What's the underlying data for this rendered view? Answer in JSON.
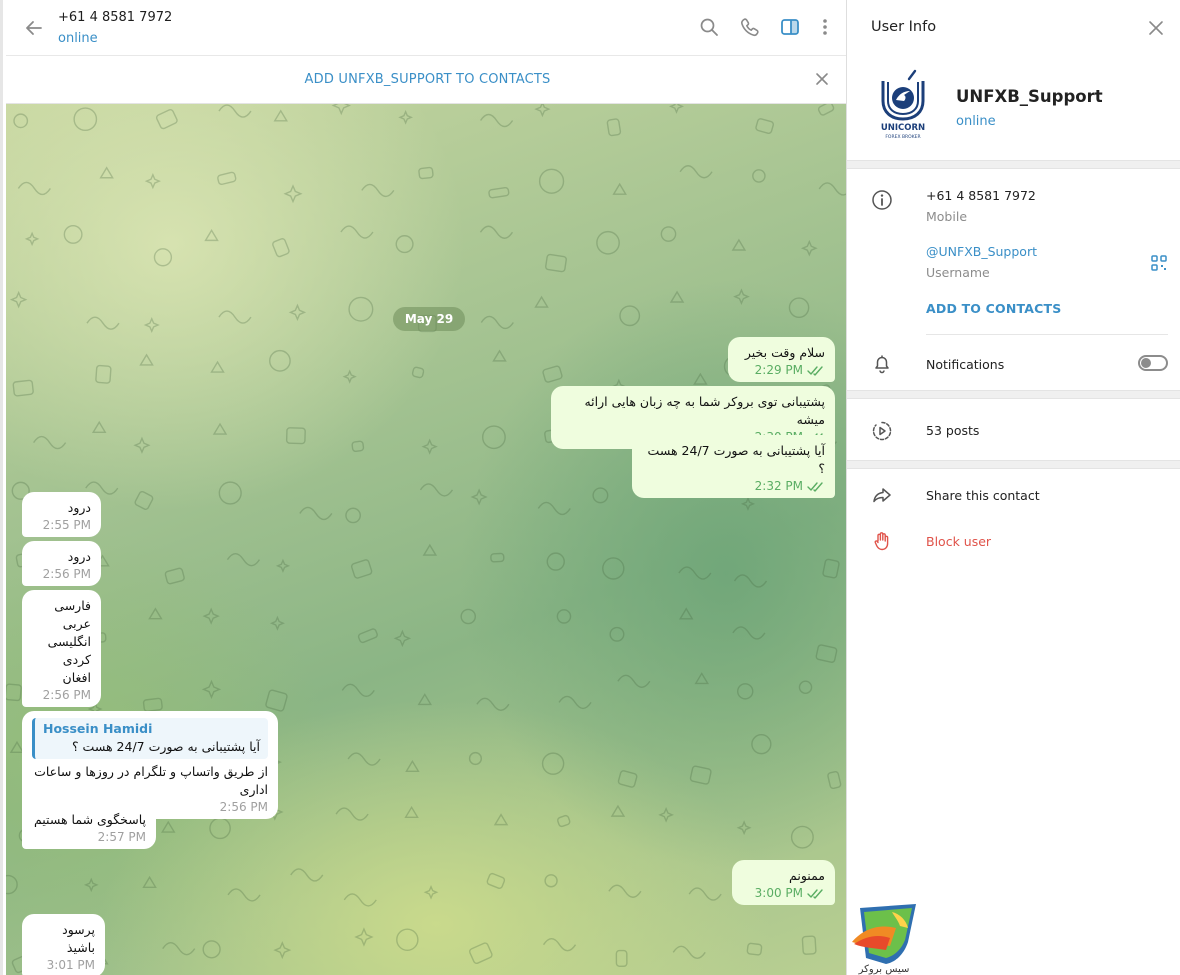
{
  "header": {
    "title": "+61 4 8581 7972",
    "status": "online"
  },
  "add_bar": {
    "label": "ADD UNFXB_SUPPORT TO CONTACTS"
  },
  "chat": {
    "date_label": "May 29",
    "messages": [
      {
        "dir": "out",
        "text": "سلام وقت بخیر",
        "time": "2:29 PM"
      },
      {
        "dir": "out",
        "text": "پشتیبانی توی بروکر شما به چه زبان هایی ارائه میشه",
        "time": "2:30 PM"
      },
      {
        "dir": "out",
        "text": "آیا پشتیبانی به صورت 24/7 هست ؟",
        "time": "2:32 PM"
      },
      {
        "dir": "in",
        "text": "درود",
        "time": "2:55 PM"
      },
      {
        "dir": "in",
        "text": "درود",
        "time": "2:56 PM"
      },
      {
        "dir": "in",
        "text": "فارسی\nعربی\nانگلیسی\nکردی\nافغان",
        "time": "2:56 PM"
      },
      {
        "dir": "in",
        "quote_name": "Hossein Hamidi",
        "quote_text": "آیا پشتیبانی به صورت 24/7 هست ؟",
        "text": "از طریق واتساپ و تلگرام در روزها و ساعات اداری",
        "time": "2:56 PM"
      },
      {
        "dir": "in",
        "text": "پاسخگوی شما هستیم",
        "time": "2:57 PM"
      },
      {
        "dir": "out",
        "text": "ممنونم",
        "time": "3:00 PM"
      },
      {
        "dir": "in",
        "text": "پرسود باشیذ",
        "time": "3:01 PM"
      }
    ]
  },
  "panel": {
    "title": "User Info",
    "name": "UNFXB_Support",
    "status": "online",
    "logo_text": "UNICORN",
    "logo_sub": "FOREX BROKER",
    "phone": "+61 4 8581 7972",
    "phone_label": "Mobile",
    "username": "@UNFXB_Support",
    "username_label": "Username",
    "add_contact": "ADD TO CONTACTS",
    "notifications": "Notifications",
    "notifications_on": false,
    "posts": "53 posts",
    "share": "Share this contact",
    "block": "Block user"
  },
  "watermark": {
    "text": "سیس بروکر"
  },
  "colors": {
    "accent": "#3a8fc7",
    "out_bubble": "#effdde",
    "check": "#5aad63",
    "danger": "#e0534a"
  }
}
